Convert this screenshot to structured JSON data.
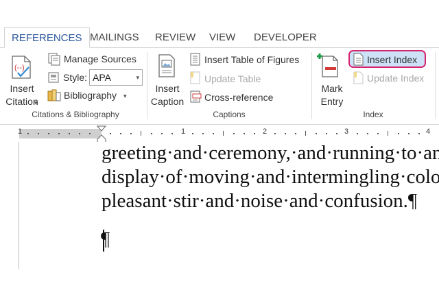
{
  "tabs": [
    {
      "label": "REFERENCES",
      "active": true
    },
    {
      "label": "MAILINGS",
      "active": false
    },
    {
      "label": "REVIEW",
      "active": false
    },
    {
      "label": "VIEW",
      "active": false
    },
    {
      "label": "DEVELOPER",
      "active": false
    }
  ],
  "citations": {
    "insert_citation_line1": "Insert",
    "insert_citation_line2": "Citation",
    "manage_sources": "Manage Sources",
    "style_label": "Style:",
    "style_value": "APA",
    "bibliography": "Bibliography",
    "group_label": "Citations & Bibliography"
  },
  "captions": {
    "insert_caption_line1": "Insert",
    "insert_caption_line2": "Caption",
    "insert_table_of_figures": "Insert Table of Figures",
    "update_table": "Update Table",
    "cross_reference": "Cross-reference",
    "group_label": "Captions"
  },
  "index": {
    "mark_entry_line1": "Mark",
    "mark_entry_line2": "Entry",
    "insert_index": "Insert Index",
    "update_index": "Update Index",
    "group_label": "Index"
  },
  "ruler": {
    "numbers": [
      "1",
      "1",
      "2",
      "3",
      "4"
    ]
  },
  "document": {
    "lines": [
      "greeting·and·ceremony,·and·running·to·an",
      "display·of·moving·and·intermingling·colo",
      "pleasant·stir·and·noise·and·confusion.¶"
    ],
    "paragraph_mark": "¶"
  },
  "colors": {
    "accent": "#2b579a",
    "highlight_border": "#d6256f",
    "highlight_fill": "#cde1f7",
    "disabled_text": "#a8a8a8"
  }
}
